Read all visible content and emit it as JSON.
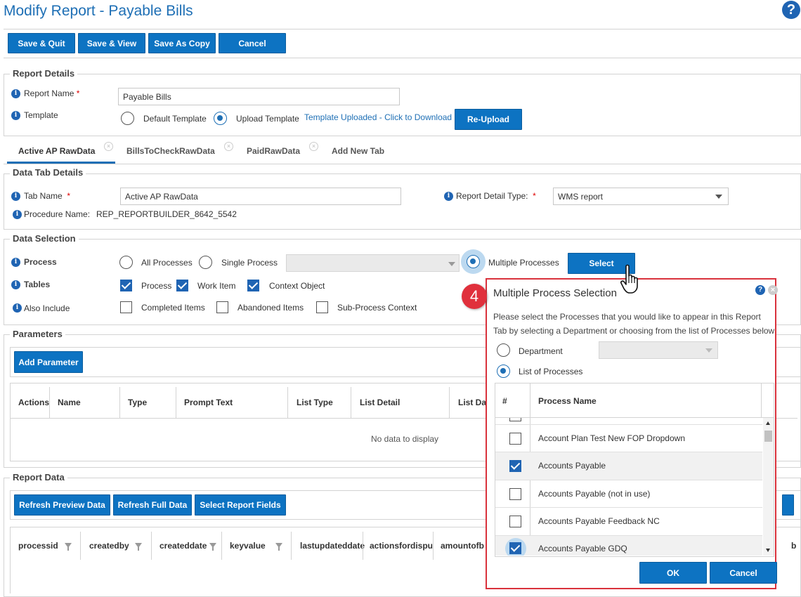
{
  "page": {
    "title": "Modify Report - Payable Bills",
    "help_label": "?"
  },
  "toolbar": {
    "save_quit": "Save & Quit",
    "save_view": "Save & View",
    "save_copy": "Save As Copy",
    "cancel": "Cancel"
  },
  "report_details": {
    "legend": "Report Details",
    "report_name_label": "Report Name",
    "required_mark": "*",
    "report_name_value": "Payable Bills",
    "template_label": "Template",
    "default_template": "Default Template",
    "upload_template": "Upload Template",
    "uploaded_link": "Template Uploaded - Click to Download",
    "reupload": "Re-Upload"
  },
  "tabs": [
    {
      "label": "Active AP RawData",
      "active": true
    },
    {
      "label": "BillsToCheckRawData",
      "active": false
    },
    {
      "label": "PaidRawData",
      "active": false
    },
    {
      "label": "Add New Tab",
      "active": false
    }
  ],
  "data_tab": {
    "legend": "Data Tab Details",
    "tab_name_label": "Tab Name",
    "tab_name_value": "Active AP RawData",
    "detail_type_label": "Report Detail Type:",
    "detail_type_value": "WMS report",
    "procedure_label": "Procedure Name:",
    "procedure_value": "REP_REPORTBUILDER_8642_5542"
  },
  "data_selection": {
    "legend": "Data Selection",
    "process_label": "Process",
    "all_processes": "All Processes",
    "single_process": "Single Process",
    "multiple_processes": "Multiple Processes",
    "select_button": "Select",
    "tables_label": "Tables",
    "process_cb": "Process",
    "work_item_cb": "Work Item",
    "context_object_cb": "Context Object",
    "also_include_label": "Also Include",
    "completed_items": "Completed Items",
    "abandoned_items": "Abandoned Items",
    "subprocess_context": "Sub-Process Context"
  },
  "parameters": {
    "legend": "Parameters",
    "add_button": "Add Parameter",
    "columns": [
      "Actions",
      "Name",
      "Type",
      "Prompt Text",
      "List Type",
      "List Detail",
      "List Da"
    ],
    "empty_text": "No data to display"
  },
  "report_data": {
    "legend": "Report Data",
    "refresh_preview": "Refresh Preview Data",
    "refresh_full": "Refresh Full Data",
    "select_fields": "Select Report Fields",
    "columns": [
      "processid",
      "createdby",
      "createddate",
      "keyvalue",
      "lastupdateddate",
      "actionsfordispu",
      "amountofb",
      "b"
    ]
  },
  "callout": {
    "number": "4"
  },
  "dialog": {
    "title": "Multiple Process Selection",
    "description": "Please select the Processes that you would like to appear in this Report Tab by selecting a Department or choosing from the list of Processes below",
    "department_label": "Department",
    "list_label": "List of Processes",
    "col_hash": "#",
    "col_name": "Process Name",
    "rows": [
      {
        "name": "Account Plan Test New FOP Dropdown",
        "checked": false
      },
      {
        "name": "Accounts Payable",
        "checked": true
      },
      {
        "name": "Accounts Payable (not in use)",
        "checked": false
      },
      {
        "name": "Accounts Payable Feedback NC",
        "checked": false
      },
      {
        "name": "Accounts Payable GDQ",
        "checked": true
      }
    ],
    "ok": "OK",
    "cancel": "Cancel"
  },
  "colors": {
    "primary": "#0d73c2",
    "title": "#1e6fb5",
    "highlight": "#d9323c"
  }
}
